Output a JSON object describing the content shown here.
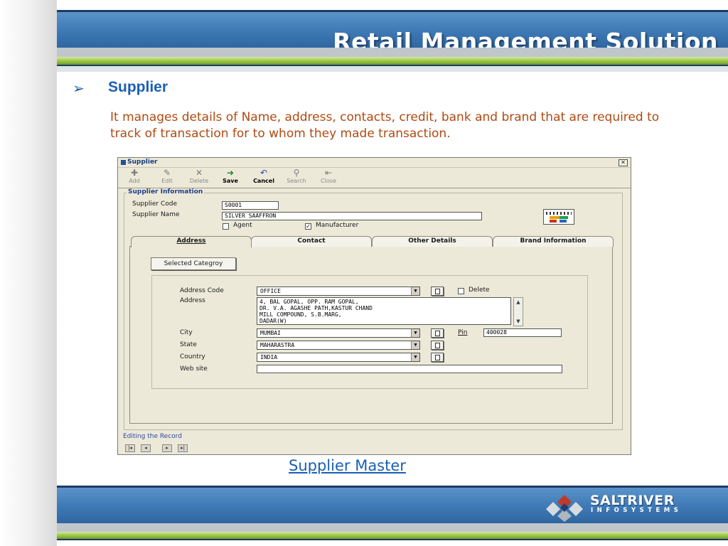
{
  "header": {
    "title": "Retail Management Solution"
  },
  "slide": {
    "section_title": "Supplier",
    "description": "It manages details of Name, address, contacts, credit, bank and brand that are required to track of transaction for to whom they made transaction.",
    "caption": "Supplier Master"
  },
  "window": {
    "title": "Supplier",
    "close_label": "✕",
    "toolbar": [
      {
        "label": "Add",
        "icon": "✚"
      },
      {
        "label": "Edit",
        "icon": "✎"
      },
      {
        "label": "Delete",
        "icon": "✕"
      },
      {
        "label": "Save",
        "icon": "➜"
      },
      {
        "label": "Cancel",
        "icon": "↶"
      },
      {
        "label": "Search",
        "icon": "⚲"
      },
      {
        "label": "Close",
        "icon": "⇤"
      }
    ],
    "group_label": "Supplier Information",
    "supplier_code_label": "Supplier Code",
    "supplier_code_value": "S0001",
    "supplier_name_label": "Supplier Name",
    "supplier_name_value": "SILVER SAAFFRON",
    "agent_label": "Agent",
    "agent_checked": false,
    "manufacturer_label": "Manufacturer",
    "manufacturer_checked": true,
    "tabs": [
      {
        "label": "Address",
        "active": true
      },
      {
        "label": "Contact",
        "active": false
      },
      {
        "label": "Other Details",
        "active": false
      },
      {
        "label": "Brand Information",
        "active": false
      }
    ],
    "selected_category_button": "Selected Categroy",
    "address_code_label": "Address Code",
    "address_code_value": "OFFICE",
    "delete_label": "Delete",
    "address_label": "Address",
    "address_lines": [
      "4, BAL GOPAL, OPP. RAM GOPAL,",
      "DR. V.A. AGASHE PATH,KASTUR CHAND",
      "MILL COMPOUND, S.B.MARG,",
      "DADAR(W)"
    ],
    "city_label": "City",
    "city_value": "MUMBAI",
    "pin_label": "Pin",
    "pin_value": "400028",
    "state_label": "State",
    "state_value": "MAHARASTRA",
    "country_label": "Country",
    "country_value": "INDIA",
    "website_label": "Web site",
    "website_value": "",
    "status_text": "Editing the Record"
  },
  "footer": {
    "logo_name": "SALTRIVER",
    "logo_sub": "INFOSYSTEMS"
  },
  "colors": {
    "accent_blue": "#1a5fb4",
    "desc_text": "#b04a12",
    "header_band": "#3f7bb7",
    "green_band": "#9cc74a"
  }
}
